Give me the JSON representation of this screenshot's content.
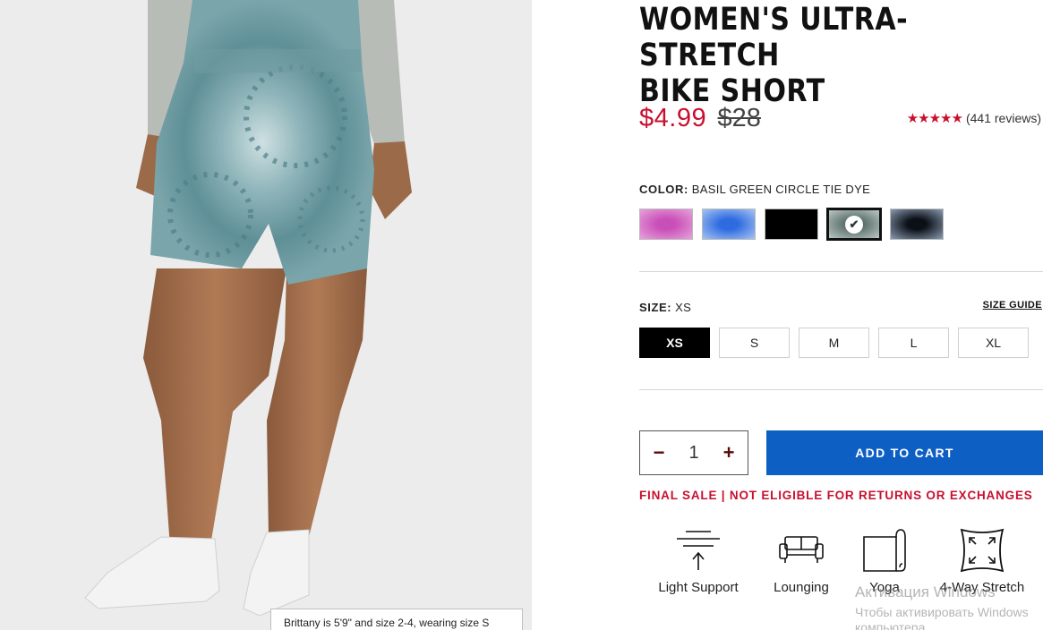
{
  "product": {
    "title_line1": "WOMEN'S ULTRA-STRETCH",
    "title_line2": "BIKE SHORT",
    "price_sale": "$4.99",
    "price_original": "$28",
    "rating_stars": 5,
    "reviews": "(441 reviews)"
  },
  "image": {
    "caption": "Brittany is 5'9\" and size 2-4, wearing size S"
  },
  "color": {
    "label": "COLOR:",
    "selected": "BASIL GREEN CIRCLE TIE DYE",
    "swatches": [
      {
        "name": "pink-tie-dye",
        "color": "#c94fb8",
        "glow": "#e6a2da"
      },
      {
        "name": "blue-tie-dye",
        "color": "#2e6be0",
        "glow": "#a7c3f2"
      },
      {
        "name": "black",
        "color": "#000000",
        "glow": "#000000"
      },
      {
        "name": "basil-green-circle-tie-dye",
        "color": "#5b6e6a",
        "glow": "#b9c8c4",
        "selected": true
      },
      {
        "name": "dark-grey-tie-dye",
        "color": "#0b0f16",
        "glow": "#8a9bb3"
      }
    ]
  },
  "size": {
    "label": "SIZE:",
    "selected": "XS",
    "guide": "SIZE GUIDE",
    "options": [
      "XS",
      "S",
      "M",
      "L",
      "XL"
    ]
  },
  "cart": {
    "quantity": "1",
    "minus": "−",
    "plus": "+",
    "add_label": "ADD TO CART"
  },
  "notice": "FINAL SALE | NOT ELIGIBLE FOR RETURNS OR EXCHANGES",
  "features": [
    {
      "icon": "light-support-icon",
      "label": "Light Support"
    },
    {
      "icon": "lounging-icon",
      "label": "Lounging"
    },
    {
      "icon": "yoga-mat-icon",
      "label": "Yoga"
    },
    {
      "icon": "four-way-stretch-icon",
      "label": "4-Way Stretch"
    }
  ],
  "watermark": {
    "line1": "Активация Windows",
    "line2": "Чтобы активировать Windows",
    "line3": "компьютера"
  },
  "colors": {
    "sale_red": "#c8102e",
    "cta_blue": "#0e5fc4",
    "fabric": "#6f9ba1"
  }
}
